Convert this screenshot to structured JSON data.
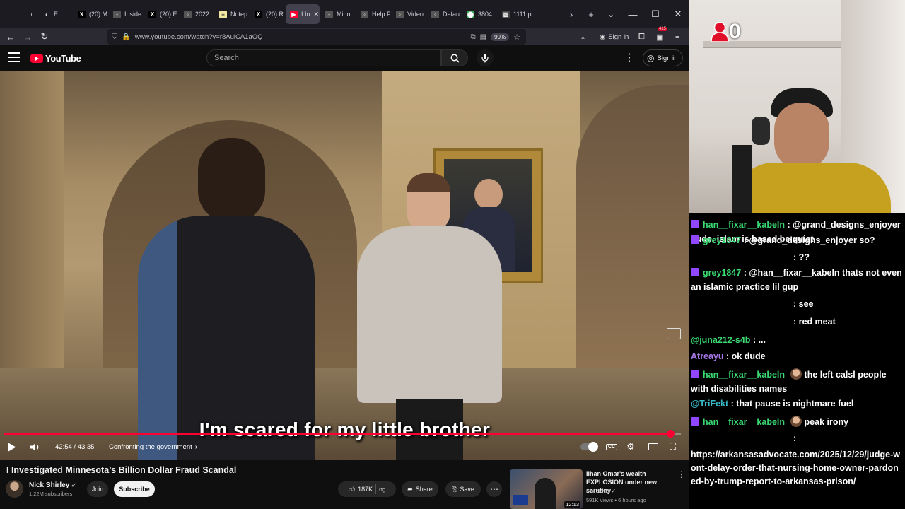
{
  "browser": {
    "tabs": [
      {
        "label": "E",
        "icon": "chevron-left-icon"
      },
      {
        "label": "(20) M",
        "icon": "x-logo-icon"
      },
      {
        "label": "Inside",
        "icon": "site-icon"
      },
      {
        "label": "(20) E",
        "icon": "x-logo-icon"
      },
      {
        "label": "2022.",
        "icon": "site-icon"
      },
      {
        "label": "Notep",
        "icon": "notepad-icon"
      },
      {
        "label": "(20) R",
        "icon": "x-logo-icon"
      },
      {
        "label": "I In",
        "icon": "youtube-icon",
        "active": true
      },
      {
        "label": "Minn",
        "icon": "site-icon"
      },
      {
        "label": "Help F",
        "icon": "site-icon"
      },
      {
        "label": "Video",
        "icon": "site-icon"
      },
      {
        "label": "Defau",
        "icon": "site-icon"
      },
      {
        "label": "3804",
        "icon": "maps-icon"
      },
      {
        "label": "1111.png",
        "icon": "image-icon"
      }
    ],
    "url": "www.youtube.com/watch?v=r8AulCA1aOQ",
    "zoom": "90%",
    "signin_label": "Sign in",
    "extension_badge": "415"
  },
  "youtube": {
    "logo_text": "YouTube",
    "search_placeholder": "Search",
    "signin_label": "Sign in"
  },
  "video": {
    "subtitle": "I'm scared for my little brother",
    "current_time": "42:54",
    "duration": "43:35",
    "time_display": "42:54 / 43:35",
    "progress_fraction": 0.984,
    "chapter": "Confronting the government",
    "title": "I Investigated Minnesota’s Billion Dollar Fraud Scandal"
  },
  "channel": {
    "name": "Nick Shirley",
    "subscribers": "1.22M subscribers",
    "join_label": "Join",
    "subscribe_label": "Subscribe"
  },
  "actions": {
    "likes": "187K",
    "share_label": "Share",
    "save_label": "Save"
  },
  "recommended": {
    "title": "Ilhan Omar's wealth EXPLOSION under new scrutiny",
    "channel": "Fox News",
    "meta": "591K views • 6 hours ago",
    "duration": "12:13"
  },
  "stream": {
    "viewer_count": "0",
    "accent": "#e0102a"
  },
  "chat": [
    {
      "user": "han__fixar__kabeln",
      "color": "#3adb72",
      "badge": true,
      "text": ": @grand_designs_enjoyer dude, islam is based be quiet"
    },
    {
      "user": "grey1847",
      "color": "#3adb72",
      "badge": true,
      "text": ": @grand_designs_enjoyer so?"
    },
    {
      "user": "",
      "color": "#ffffff",
      "badge": false,
      "text": ": ??"
    },
    {
      "user": "grey1847",
      "color": "#3adb72",
      "badge": true,
      "text": ": @han__fixar__kabeln thats not even an islamic practice lil gup"
    },
    {
      "user": "",
      "color": "#ffffff",
      "badge": false,
      "text": ": see"
    },
    {
      "user": "",
      "color": "#ffffff",
      "badge": false,
      "text": ": red meat"
    },
    {
      "user": "@juna212-s4b",
      "color": "#3adb72",
      "badge": false,
      "text": ": ..."
    },
    {
      "user": "Atreayu",
      "color": "#a678e8",
      "badge": false,
      "text": ": ok dude"
    },
    {
      "user": "han__fixar__kabeln",
      "color": "#3adb72",
      "badge": true,
      "emote": true,
      "text": "the left calsl people with disabilities names"
    },
    {
      "user": "@TriFekt",
      "color": "#38b8c8",
      "badge": false,
      "text": ": that pause is nightmare fuel"
    },
    {
      "user": "han__fixar__kabeln",
      "color": "#3adb72",
      "badge": true,
      "emote": true,
      "text": "peak irony"
    },
    {
      "user": "",
      "color": "#ffffff",
      "badge": false,
      "text": ":"
    },
    {
      "user": "",
      "color": "#ffffff",
      "badge": false,
      "text": "https://arkansasadvocate.com/2025/12/29/judge-wont-delay-order-that-nursing-home-owner-pardoned-by-trump-report-to-arkansas-prison/"
    }
  ]
}
